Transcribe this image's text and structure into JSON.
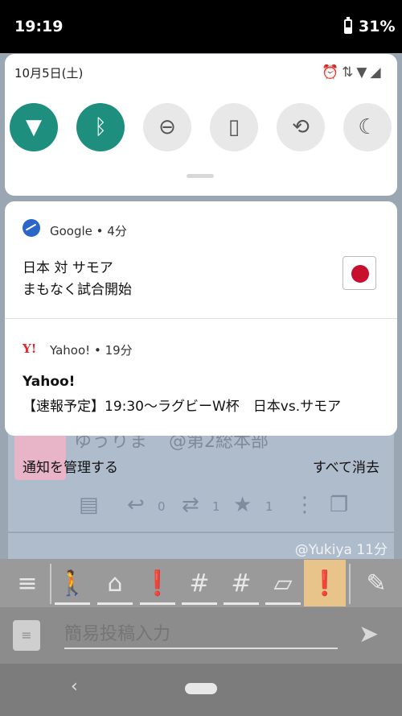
{
  "status_bar": {
    "time": "19:19",
    "battery": "31%"
  },
  "quick_settings": {
    "date": "10月5日(土)",
    "status_icons": [
      "alarm-icon",
      "data-arrows-icon",
      "wifi-icon",
      "signal-icon"
    ],
    "tiles": [
      {
        "name": "wifi",
        "icon": "wifi-icon",
        "on": true
      },
      {
        "name": "bluetooth",
        "icon": "bluetooth-icon",
        "on": true
      },
      {
        "name": "do-not-disturb",
        "icon": "dnd-icon",
        "on": false
      },
      {
        "name": "flashlight",
        "icon": "flashlight-icon",
        "on": false
      },
      {
        "name": "auto-rotate",
        "icon": "rotate-icon",
        "on": false
      },
      {
        "name": "night-mode",
        "icon": "moon-icon",
        "on": false
      }
    ],
    "accent_color": "#1e8f7e"
  },
  "notifications": {
    "google": {
      "app": "Google",
      "time_sep": " • ",
      "time": "4分",
      "line1": "日本 対 サモア",
      "line2": "まもなく試合開始"
    },
    "yahoo": {
      "logo": "Y!",
      "app": "Yahoo!",
      "time_sep": " • ",
      "time": "19分",
      "title": "Yahoo!",
      "body": "【速報予定】19:30〜ラグビーW杯　日本vs.サモア"
    }
  },
  "background_app": {
    "username": "ゆうりま",
    "handle": "@第2総本部",
    "manage_label": "通知を管理する",
    "clear_all_label": "すべて消去",
    "reply_count": "0",
    "retweet_count": "1",
    "fav_count": "1",
    "mention": "@Yukiya",
    "mention_time": "11分"
  },
  "toolbar": {
    "tabs": [
      "walk-icon",
      "home-icon",
      "notification-icon",
      "hashtag-icon",
      "hashtag-icon",
      "list-icon",
      "notification-icon"
    ]
  },
  "composer": {
    "placeholder": "簡易投稿入力"
  }
}
